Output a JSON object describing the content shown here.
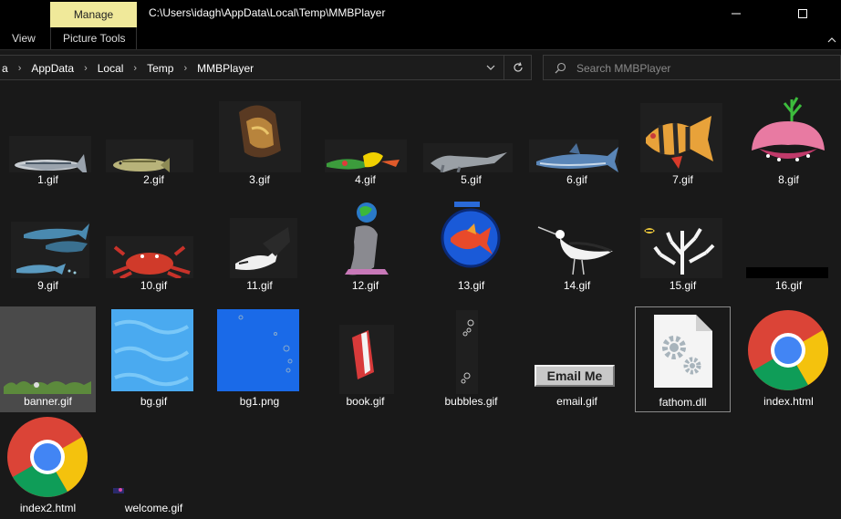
{
  "titlebar": {
    "context_tab": "Manage",
    "path_title": "C:\\Users\\idagh\\AppData\\Local\\Temp\\MMBPlayer"
  },
  "ribbon": {
    "tab_view": "View",
    "tab_picture_tools": "Picture Tools"
  },
  "address": {
    "crumbs": [
      "a",
      "AppData",
      "Local",
      "Temp",
      "MMBPlayer"
    ]
  },
  "search": {
    "placeholder": "Search MMBPlayer"
  },
  "files": [
    {
      "name": "1.gif"
    },
    {
      "name": "2.gif"
    },
    {
      "name": "3.gif"
    },
    {
      "name": "4.gif"
    },
    {
      "name": "5.gif"
    },
    {
      "name": "6.gif"
    },
    {
      "name": "7.gif"
    },
    {
      "name": "8.gif"
    },
    {
      "name": "9.gif"
    },
    {
      "name": "10.gif"
    },
    {
      "name": "11.gif"
    },
    {
      "name": "12.gif"
    },
    {
      "name": "13.gif"
    },
    {
      "name": "14.gif"
    },
    {
      "name": "15.gif"
    },
    {
      "name": "16.gif"
    },
    {
      "name": "banner.gif"
    },
    {
      "name": "bg.gif"
    },
    {
      "name": "bg1.png"
    },
    {
      "name": "book.gif"
    },
    {
      "name": "bubbles.gif"
    },
    {
      "name": "email.gif",
      "thumb_text": "Email Me"
    },
    {
      "name": "fathom.dll"
    },
    {
      "name": "index.html"
    },
    {
      "name": "index2.html"
    },
    {
      "name": "welcome.gif"
    }
  ],
  "colors": {
    "context_tab_bg": "#f0e99a",
    "background": "#191919",
    "selection": "#4a4a4a"
  }
}
